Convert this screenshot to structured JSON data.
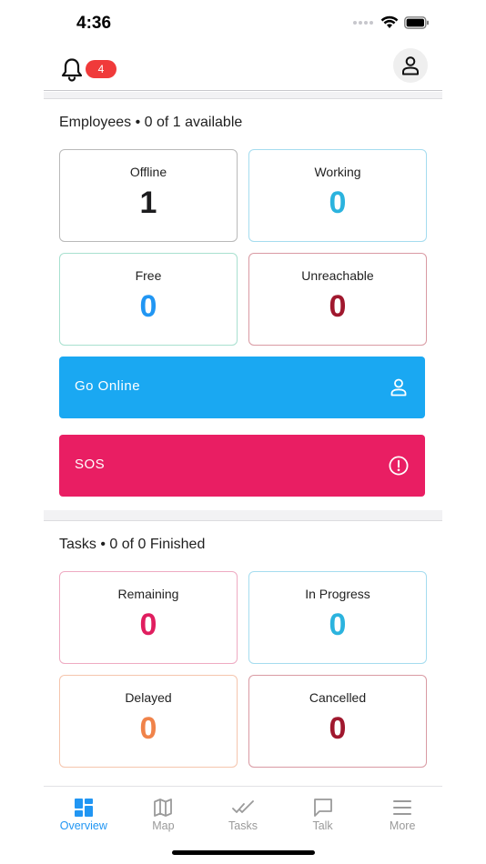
{
  "status_bar": {
    "time": "4:36"
  },
  "header": {
    "notifications_badge": "4"
  },
  "employees": {
    "title": "Employees • 0 of 1 available",
    "cards": [
      {
        "label": "Offline",
        "value": "1",
        "color": "#1c1c1e",
        "border": "#b9b9b9"
      },
      {
        "label": "Working",
        "value": "0",
        "color": "#2bb3de",
        "border": "#a5dcef"
      },
      {
        "label": "Free",
        "value": "0",
        "color": "#2196f3",
        "border": "#a8e0cf"
      },
      {
        "label": "Unreachable",
        "value": "0",
        "color": "#a0182e",
        "border": "#d99aa3"
      }
    ]
  },
  "actions": {
    "go_online": {
      "label": "Go Online",
      "color": "#1aa8f2",
      "icon": "person-icon"
    },
    "sos": {
      "label": "SOS",
      "color": "#e91e63",
      "icon": "alert-circle-icon"
    }
  },
  "tasks": {
    "title": "Tasks • 0 of 0 Finished",
    "cards": [
      {
        "label": "Remaining",
        "value": "0",
        "color": "#e01e5f",
        "border": "#eeaac2"
      },
      {
        "label": "In Progress",
        "value": "0",
        "color": "#2bb3de",
        "border": "#a5dcef"
      },
      {
        "label": "Delayed",
        "value": "0",
        "color": "#f0834a",
        "border": "#f5c5ad"
      },
      {
        "label": "Cancelled",
        "value": "0",
        "color": "#a0182e",
        "border": "#d99aa3"
      }
    ]
  },
  "tab_bar": {
    "items": [
      {
        "label": "Overview",
        "icon": "dashboard-icon",
        "active": true
      },
      {
        "label": "Map",
        "icon": "map-icon",
        "active": false
      },
      {
        "label": "Tasks",
        "icon": "double-check-icon",
        "active": false
      },
      {
        "label": "Talk",
        "icon": "chat-icon",
        "active": false
      },
      {
        "label": "More",
        "icon": "menu-icon",
        "active": false
      }
    ],
    "active_color": "#2196f3",
    "inactive_color": "#9a9a9a"
  }
}
